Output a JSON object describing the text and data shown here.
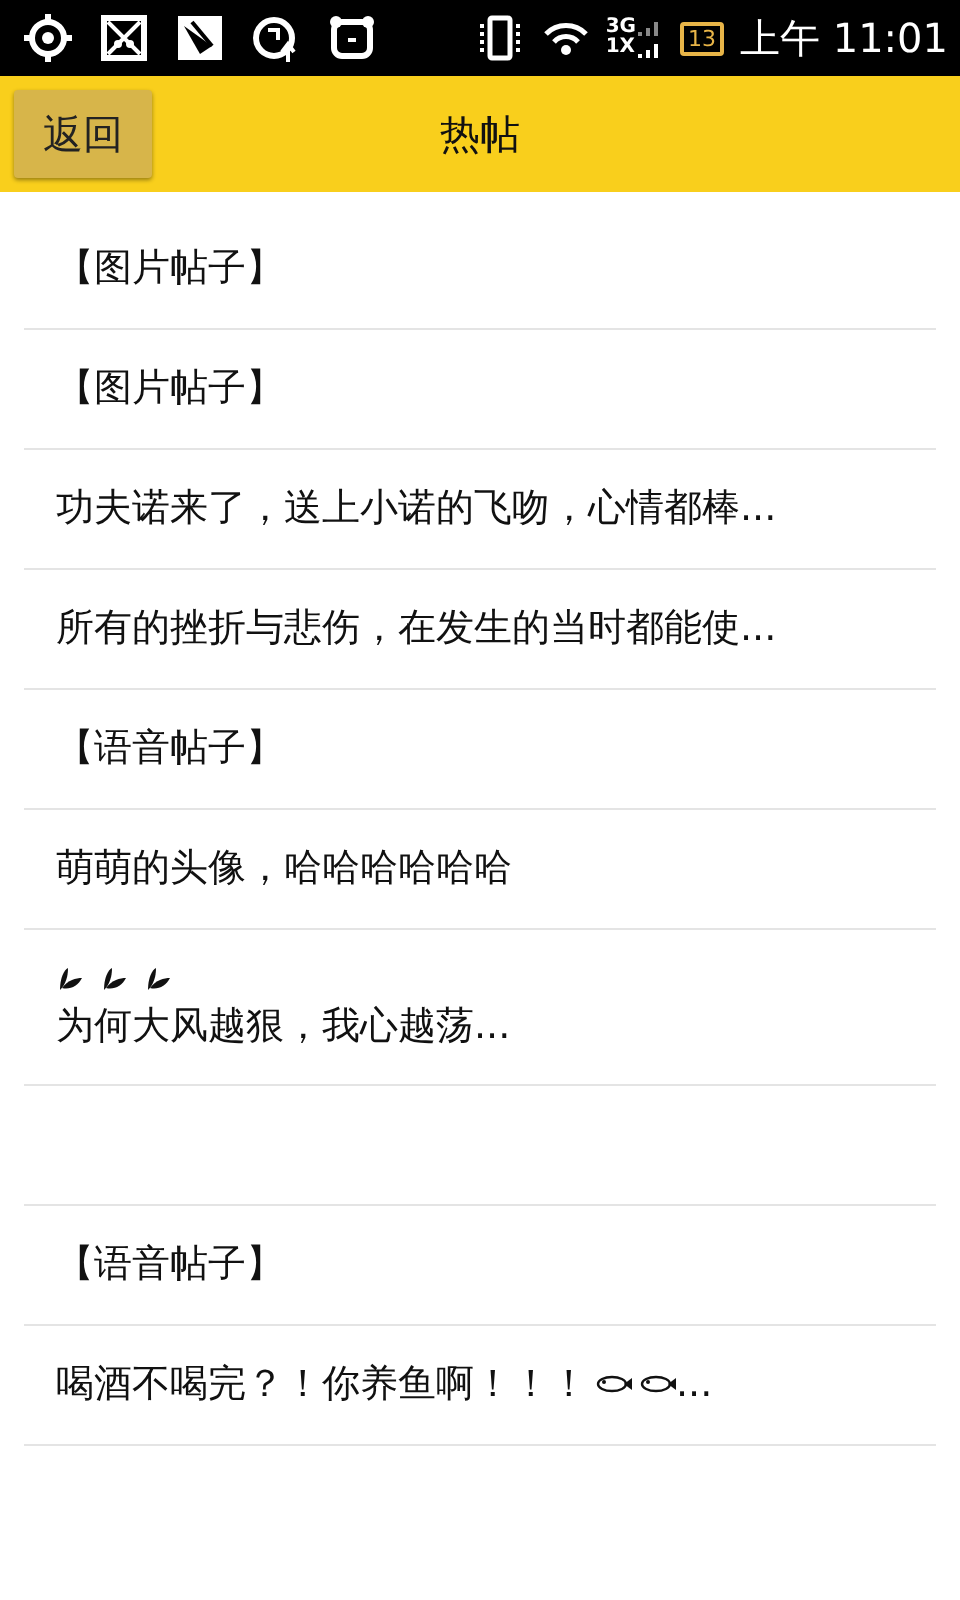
{
  "status_bar": {
    "network_top": "3G",
    "network_bottom": "1X",
    "battery": "13",
    "time": "上午 11:01"
  },
  "header": {
    "back_button": "返回",
    "title": "热帖"
  },
  "posts": [
    {
      "kind": "text",
      "text": "【图片帖子】"
    },
    {
      "kind": "text",
      "text": "【图片帖子】"
    },
    {
      "kind": "text",
      "text": "功夫诺来了，送上小诺的飞吻，心情都棒..."
    },
    {
      "kind": "text",
      "text": "所有的挫折与悲伤，在发生的当时都能使..."
    },
    {
      "kind": "text",
      "text": "【语音帖子】"
    },
    {
      "kind": "text",
      "text": "萌萌的头像，哈哈哈哈哈哈"
    },
    {
      "kind": "leaf-prefix",
      "text": "为何大风越狠，我心越荡..."
    },
    {
      "kind": "blank"
    },
    {
      "kind": "text",
      "text": "【语音帖子】"
    },
    {
      "kind": "fish-suffix",
      "text": "喝酒不喝完？！你养鱼啊！！！",
      "after": "..."
    }
  ]
}
